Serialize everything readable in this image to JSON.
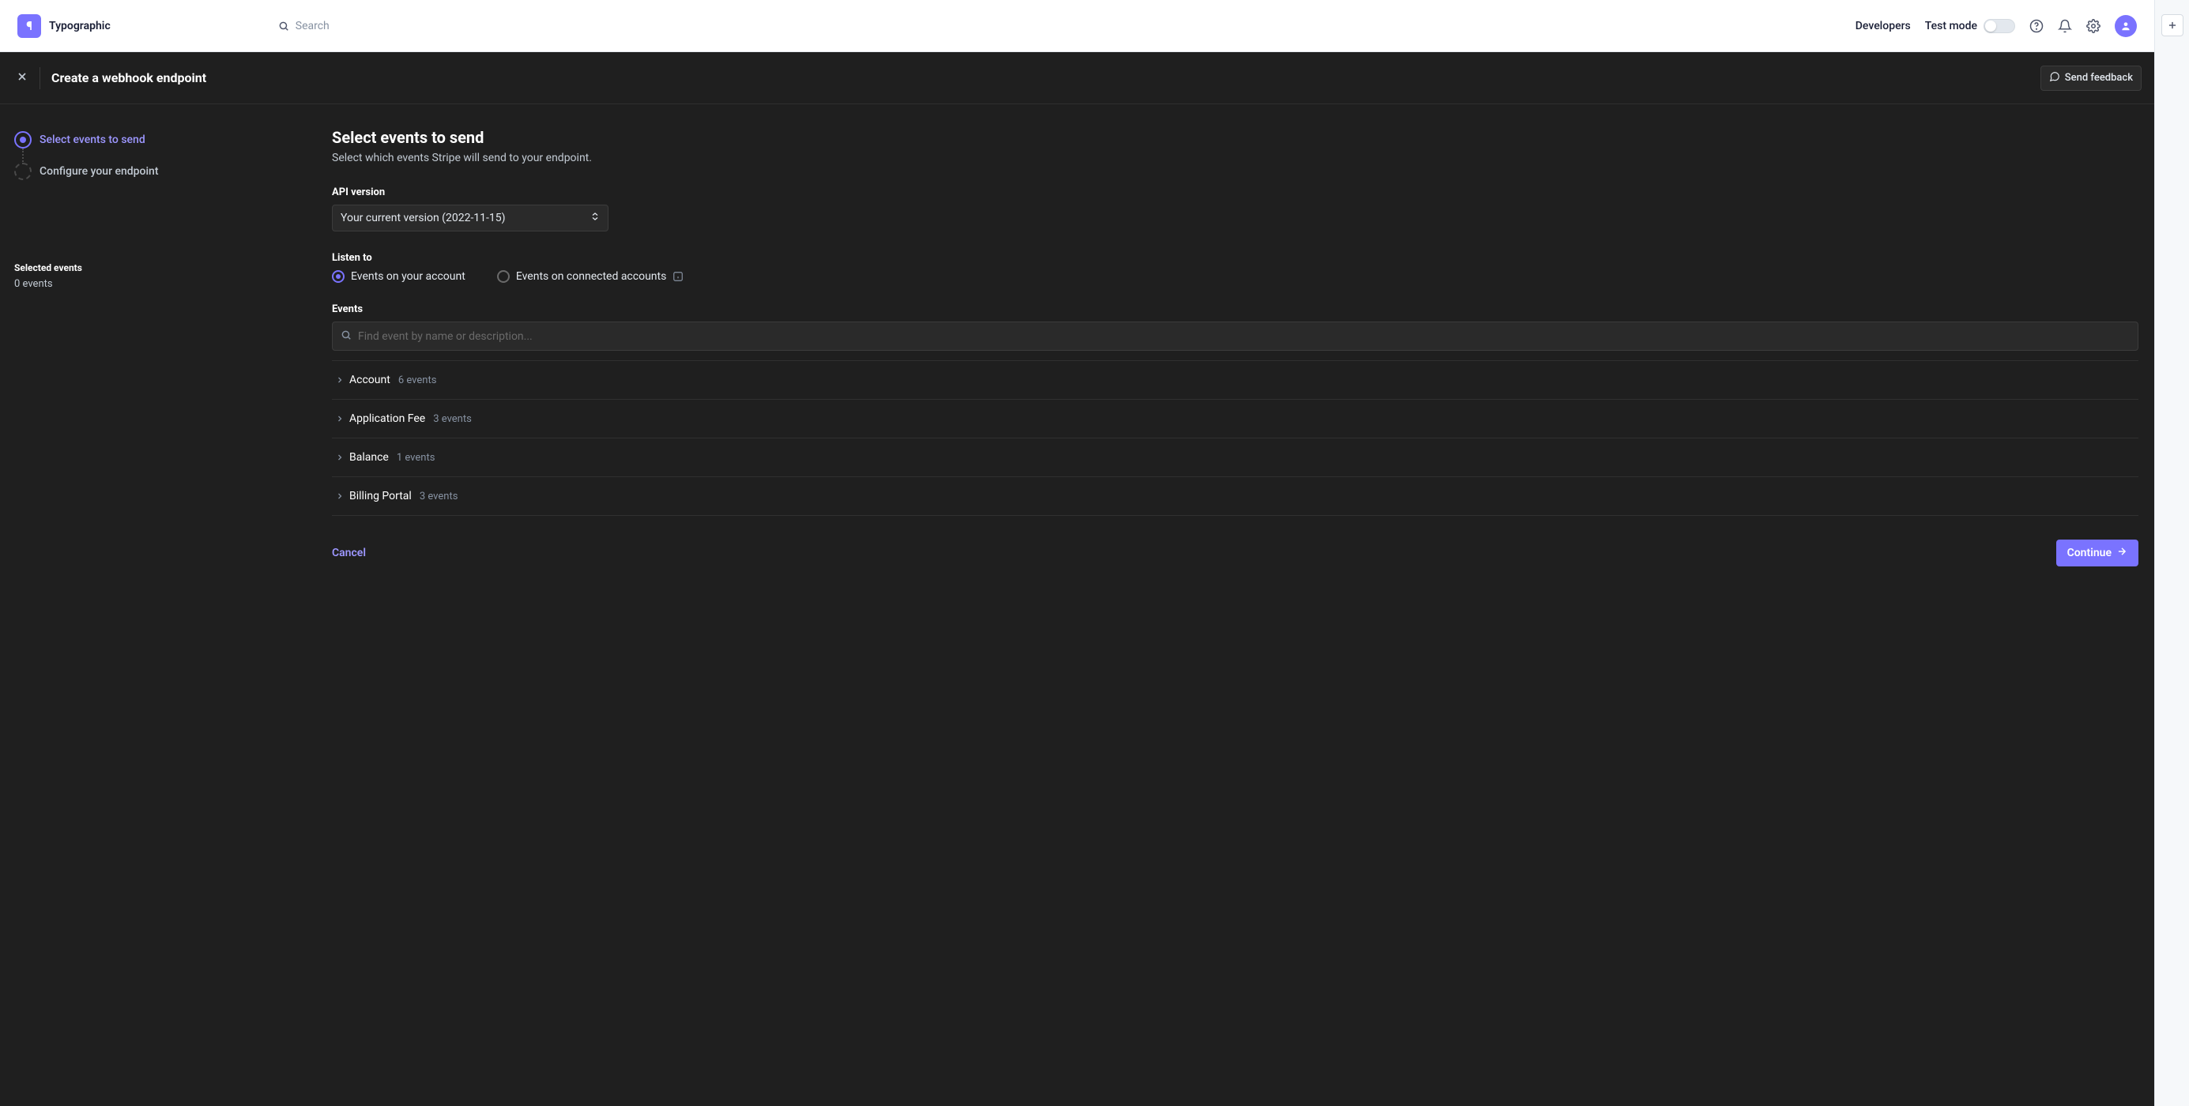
{
  "brand": {
    "name": "Typographic",
    "logo_letter": "¶"
  },
  "topbar": {
    "search_placeholder": "Search",
    "developers_label": "Developers",
    "testmode_label": "Test mode"
  },
  "subheader": {
    "title": "Create a webhook endpoint",
    "feedback_label": "Send feedback"
  },
  "sidebar": {
    "steps": [
      {
        "label": "Select events to send",
        "state": "active"
      },
      {
        "label": "Configure your endpoint",
        "state": "pending"
      }
    ],
    "selected_events_title": "Selected events",
    "selected_events_count": "0 events"
  },
  "panel": {
    "heading": "Select events to send",
    "subheading": "Select which events Stripe will send to your endpoint.",
    "api_version_label": "API version",
    "api_version_value": "Your current version (2022-11-15)",
    "listen_to_label": "Listen to",
    "radio_account": "Events on your account",
    "radio_connected": "Events on connected accounts",
    "events_label": "Events",
    "events_search_placeholder": "Find event by name or description...",
    "categories": [
      {
        "name": "Account",
        "count": "6 events"
      },
      {
        "name": "Application Fee",
        "count": "3 events"
      },
      {
        "name": "Balance",
        "count": "1 events"
      },
      {
        "name": "Billing Portal",
        "count": "3 events"
      }
    ],
    "cancel_label": "Cancel",
    "continue_label": "Continue"
  }
}
